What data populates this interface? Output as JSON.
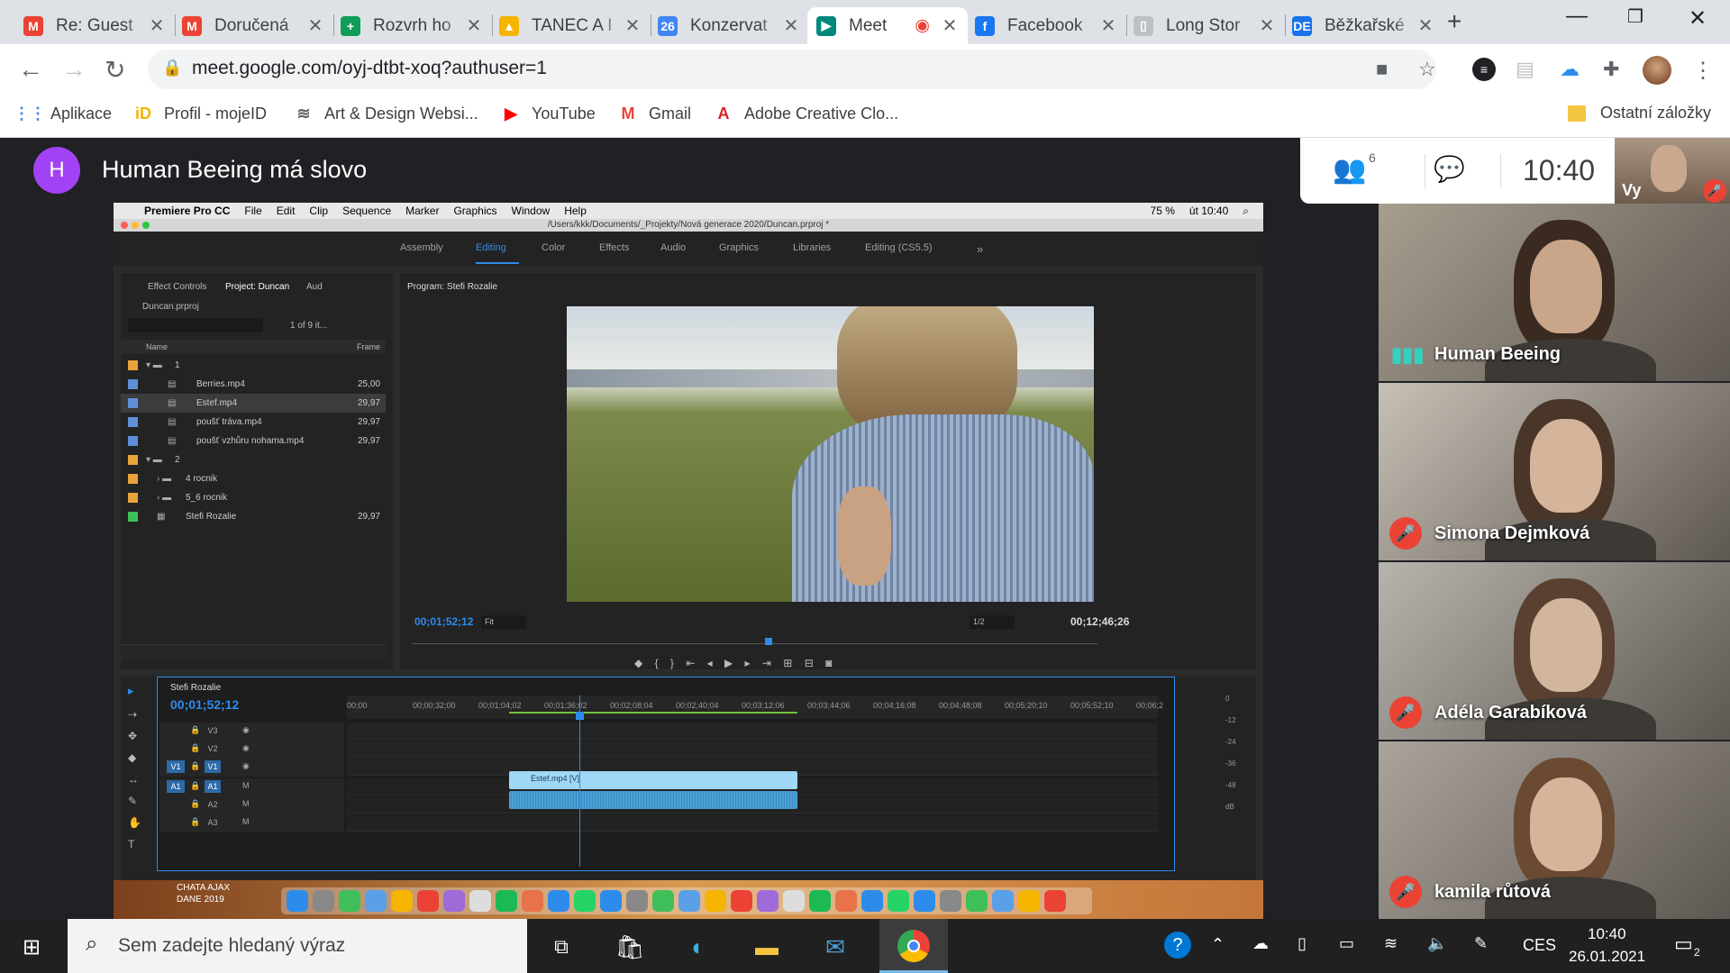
{
  "tabs": [
    {
      "title": "Re: Guest",
      "icon": "gmail-icon",
      "color": "#ea4335",
      "glyph": "M"
    },
    {
      "title": "Doručená",
      "icon": "gmail-icon",
      "color": "#ea4335",
      "glyph": "M"
    },
    {
      "title": "Rozvrh ho",
      "icon": "sheets-icon",
      "color": "#0f9d58",
      "glyph": "+"
    },
    {
      "title": "TANEC A I",
      "icon": "drive-icon",
      "color": "#f4b400",
      "glyph": "▲"
    },
    {
      "title": "Konzervat",
      "icon": "calendar-icon",
      "color": "#4285f4",
      "glyph": "26"
    },
    {
      "title": "Meet",
      "icon": "meet-icon",
      "color": "#00897b",
      "glyph": "▶"
    },
    {
      "title": "Facebook",
      "icon": "facebook-icon",
      "color": "#1877f2",
      "glyph": "f"
    },
    {
      "title": "Long Stor",
      "icon": "document-icon",
      "color": "#bdc1c6",
      "glyph": "▯"
    },
    {
      "title": "Běžkařské",
      "icon": "de-icon",
      "color": "#1a73e8",
      "glyph": "DE"
    }
  ],
  "address": {
    "url": "meet.google.com/oyj-dtbt-xoq?authuser=1"
  },
  "bookmarks": [
    {
      "label": "Aplikace",
      "icon": "apps-grid-icon",
      "color": "#4285f4",
      "glyph": "⋮⋮"
    },
    {
      "label": "Profil - mojeID",
      "icon": "mojeid-icon",
      "color": "#f4b400",
      "glyph": "iD"
    },
    {
      "label": "Art & Design Websi...",
      "icon": "art-design-icon",
      "color": "#5f6368",
      "glyph": "≋"
    },
    {
      "label": "YouTube",
      "icon": "youtube-icon",
      "color": "#ff0000",
      "glyph": "▶"
    },
    {
      "label": "Gmail",
      "icon": "gmail-icon",
      "color": "#ea4335",
      "glyph": "M"
    },
    {
      "label": "Adobe Creative Clo...",
      "icon": "adobe-icon",
      "color": "#da1f26",
      "glyph": "A"
    }
  ],
  "other_bookmarks": "Ostatní záložky",
  "meet": {
    "avatar_letter": "H",
    "title": "Human Beeing má slovo",
    "participant_count": "6",
    "clock": "10:40",
    "self_label": "Vy",
    "participants": [
      {
        "name": "Human Beeing",
        "speaking": true,
        "bg": "#a79e8f",
        "skin": "#c9a58a",
        "hair": "#3a2a20"
      },
      {
        "name": "Simona Dejmková",
        "speaking": false,
        "bg": "#c7c0b6",
        "skin": "#d4b49a",
        "hair": "#4a3629"
      },
      {
        "name": "Adéla Garabíková",
        "speaking": false,
        "bg": "#b7b3ad",
        "skin": "#d2b59d",
        "hair": "#5a4030"
      },
      {
        "name": "kamila růtová",
        "speaking": false,
        "bg": "#aaa49c",
        "skin": "#d6b49b",
        "hair": "#6b4a33"
      }
    ]
  },
  "premiere": {
    "menu": [
      "Premiere Pro CC",
      "File",
      "Edit",
      "Clip",
      "Sequence",
      "Marker",
      "Graphics",
      "Window",
      "Help"
    ],
    "status": [
      "75 %",
      "út 10:40"
    ],
    "project_path": "/Users/kkk/Documents/_Projekty/Nová generace 2020/Duncan.prproj *",
    "workspaces": [
      "Assembly",
      "Editing",
      "Color",
      "Effects",
      "Audio",
      "Graphics",
      "Libraries",
      "Editing (CS5.5)"
    ],
    "panel_tabs": [
      "Effect Controls",
      "Project: Duncan",
      "Aud"
    ],
    "project_file": "Duncan.prproj",
    "item_count": "1 of 9 it...",
    "col_name": "Name",
    "col_frame": "Frame",
    "items": [
      {
        "name": "1",
        "frame": "",
        "color": "#e8a33d",
        "indent": 0,
        "type": "folder-open"
      },
      {
        "name": "Berries.mp4",
        "frame": "25,00",
        "color": "#5f8fd6",
        "indent": 2,
        "type": "clip"
      },
      {
        "name": "Estef.mp4",
        "frame": "29,97",
        "color": "#5f8fd6",
        "indent": 2,
        "type": "clip",
        "selected": true
      },
      {
        "name": "poušť tráva.mp4",
        "frame": "29,97",
        "color": "#5f8fd6",
        "indent": 2,
        "type": "clip"
      },
      {
        "name": "poušť vzhůru nohama.mp4",
        "frame": "29,97",
        "color": "#5f8fd6",
        "indent": 2,
        "type": "clip"
      },
      {
        "name": "2",
        "frame": "",
        "color": "#e8a33d",
        "indent": 0,
        "type": "folder-open"
      },
      {
        "name": "4 rocnik",
        "frame": "",
        "color": "#e8a33d",
        "indent": 1,
        "type": "folder"
      },
      {
        "name": "5_6 rocnik",
        "frame": "",
        "color": "#e8a33d",
        "indent": 1,
        "type": "folder"
      },
      {
        "name": "Stefi Rozalie",
        "frame": "29,97",
        "color": "#3fbf5a",
        "indent": 1,
        "type": "sequence"
      }
    ],
    "program_title": "Program: Stefi Rozalie",
    "timecode": "00;01;52;12",
    "fit": "Fit",
    "resolution": "1/2",
    "duration": "00;12;46;26",
    "sequence_name": "Stefi Rozalie",
    "timeline_tc": "00;01;52;12",
    "ruler": [
      "00;00",
      "00;00;32;00",
      "00;01;04;02",
      "00;01;36;02",
      "00;02;08;04",
      "00;02;40;04",
      "00;03;12;06",
      "00;03;44;06",
      "00;04;16;08",
      "00;04;48;08",
      "00;05;20;10",
      "00;05;52;10",
      "00;06;2"
    ],
    "tracks": [
      "V3",
      "V2",
      "V1",
      "A1",
      "A2",
      "A3"
    ],
    "clip_label": "Estef.mp4 [V]",
    "meter": [
      "0",
      "-12",
      "-24",
      "-36",
      "-48",
      "dB"
    ],
    "dock_labels": [
      "CHATA AJAX",
      "DANE 2019"
    ]
  },
  "taskbar": {
    "search_placeholder": "Sem zadejte hledaný výraz",
    "lang": "CES",
    "time": "10:40",
    "date": "26.01.2021",
    "notifications": "2"
  }
}
